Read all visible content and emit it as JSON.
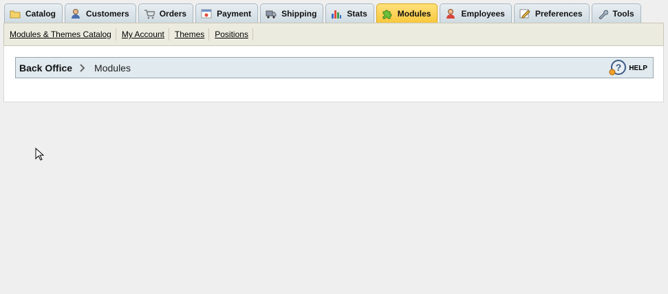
{
  "tabs": [
    {
      "label": "Catalog",
      "icon": "folder-icon"
    },
    {
      "label": "Customers",
      "icon": "user-icon"
    },
    {
      "label": "Orders",
      "icon": "cart-icon"
    },
    {
      "label": "Payment",
      "icon": "payment-icon"
    },
    {
      "label": "Shipping",
      "icon": "truck-icon"
    },
    {
      "label": "Stats",
      "icon": "bar-chart-icon"
    },
    {
      "label": "Modules",
      "icon": "puzzle-icon",
      "active": true
    },
    {
      "label": "Employees",
      "icon": "employee-icon"
    },
    {
      "label": "Preferences",
      "icon": "preferences-icon"
    },
    {
      "label": "Tools",
      "icon": "wrench-icon"
    }
  ],
  "subnav": [
    "Modules & Themes Catalog",
    "My Account",
    "Themes",
    "Positions"
  ],
  "breadcrumb": {
    "root": "Back Office",
    "current": "Modules"
  },
  "help": {
    "label": "HELP",
    "icon": "help-icon"
  },
  "colors": {
    "active_tab": "#f8c63a",
    "tab": "#cfdbe2",
    "subnav_bg": "#ecebdf",
    "crumb_bg": "#e0eaef",
    "page_bg": "#efefef"
  }
}
